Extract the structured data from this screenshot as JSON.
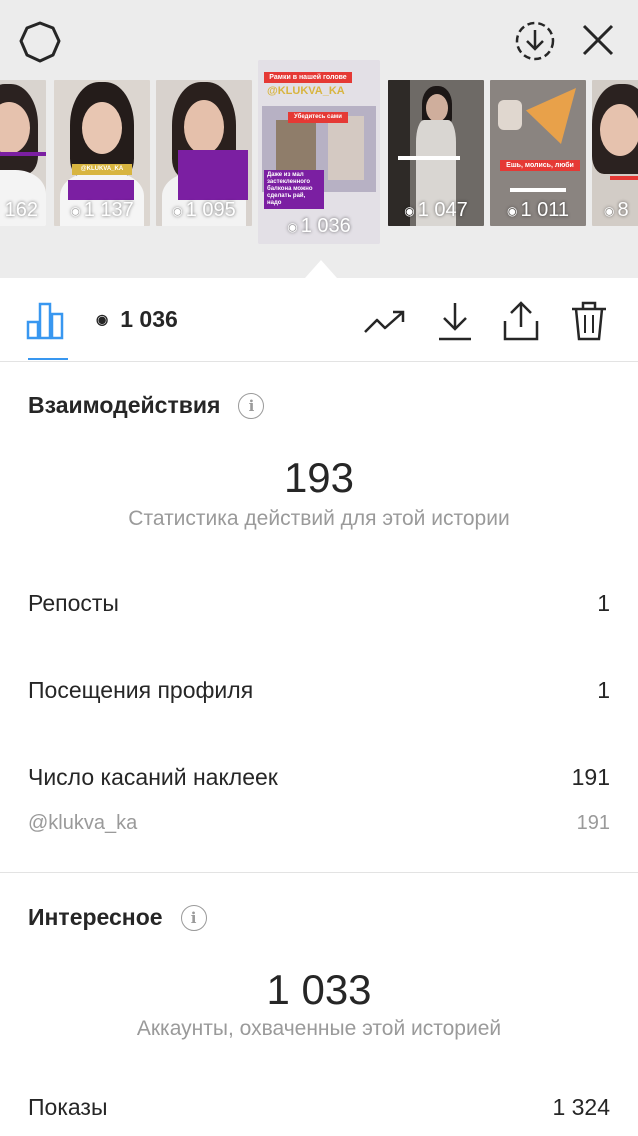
{
  "header": {
    "settings_icon": "settings-gear-icon",
    "archive_icon": "archive-download-icon",
    "close_icon": "close-icon"
  },
  "thumbnails": [
    {
      "views": "162",
      "caption": "",
      "selected": false
    },
    {
      "views": "1 137",
      "caption": "@KLUKVA_KA",
      "selected": false
    },
    {
      "views": "1 095",
      "caption": "",
      "selected": false
    },
    {
      "views": "1 036",
      "title": "Рамки в нашей голове",
      "handle": "@KLUKVA_KA",
      "caption": "Убедитесь сами",
      "caption2": "Даже из мал застекленного балкона можно сделать рай, надо",
      "selected": true
    },
    {
      "views": "1 047",
      "caption": "",
      "selected": false
    },
    {
      "views": "1 011",
      "caption": "Ешь, молись, люби",
      "selected": false
    },
    {
      "views": "8",
      "caption": "",
      "selected": false
    }
  ],
  "toolbar": {
    "view_count": "1 036",
    "insights_icon": "bar-chart-icon",
    "eye_icon": "eye-icon",
    "actions": [
      "trend-icon",
      "download-icon",
      "share-icon",
      "trash-icon"
    ]
  },
  "interactions": {
    "title": "Взаимодействия",
    "total": "193",
    "caption": "Статистика действий для этой истории",
    "rows": [
      {
        "label": "Репосты",
        "value": "1"
      },
      {
        "label": "Посещения профиля",
        "value": "1"
      },
      {
        "label": "Число касаний наклеек",
        "value": "191"
      },
      {
        "label": "@klukva_ka",
        "value": "191"
      }
    ]
  },
  "discovery": {
    "title": "Интересное",
    "total": "1 033",
    "caption": "Аккаунты, охваченные этой историей",
    "rows": [
      {
        "label": "Показы",
        "value": "1 324"
      }
    ]
  },
  "colors": {
    "accent": "#3897f0",
    "text": "#262626",
    "muted": "#9a9a9a",
    "top_bg": "#ececec"
  }
}
